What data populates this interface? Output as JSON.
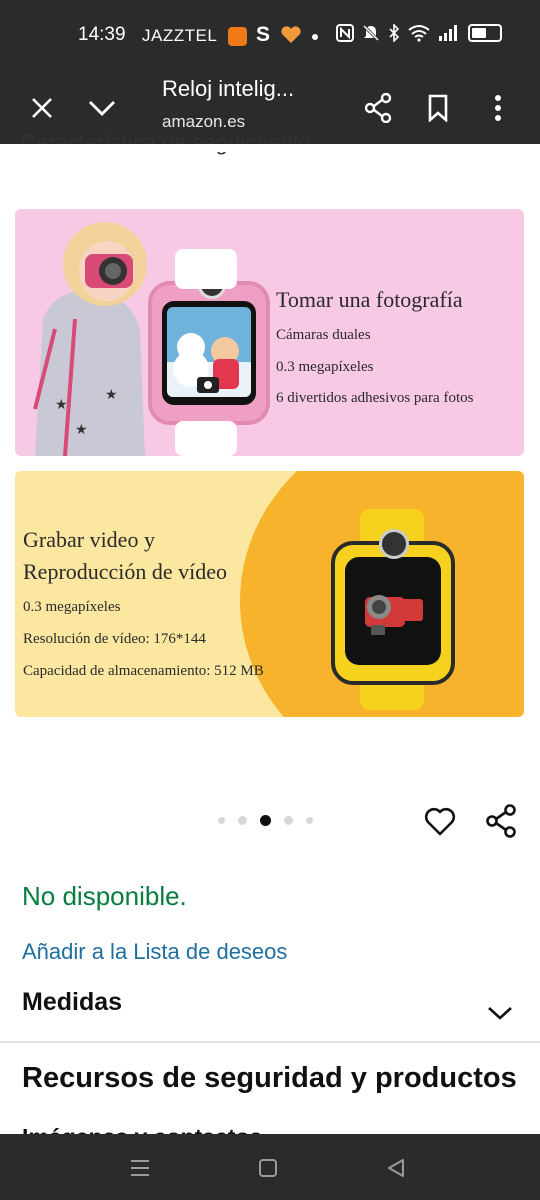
{
  "status_bar": {
    "time": "14:39",
    "carrier": "JAZZTEL",
    "s_icon": "S"
  },
  "toolbar": {
    "page_title": "Reloj intelig...",
    "domain": "amazon.es"
  },
  "clipped_text": "Característica de seguimiento",
  "banner1": {
    "title": "Tomar una fotografía",
    "lines": [
      "Cámaras duales",
      "0.3 megapíxeles",
      "6 divertidos adhesivos para fotos"
    ]
  },
  "banner2": {
    "title_line1": "Grabar video y",
    "title_line2": "Reproducción de vídeo",
    "lines": [
      "0.3 megapíxeles",
      "Resolución de vídeo: 176*144",
      "Capacidad de almacenamiento: 512 MB"
    ]
  },
  "carousel": {
    "current_index": 3,
    "total": 5
  },
  "product": {
    "availability": "No disponible.",
    "wishlist_link": "Añadir a la Lista de deseos",
    "measures_heading": "Medidas",
    "safety_heading": "Recursos de seguridad y productos",
    "images_heading": "Imágenes y contactos"
  },
  "colors": {
    "bar_bg": "#2b2b2b",
    "availability": "#067d3e",
    "link": "#1f6fa0",
    "banner_pink": "#f7c9e5",
    "banner_yellow": "#fce7a0",
    "banner_orange": "#f7b32b"
  },
  "icons": [
    "close-icon",
    "chevron-down-icon",
    "share-icon",
    "bookmark-icon",
    "more-vert-icon",
    "heart-icon",
    "share-icon",
    "nav-menu-icon",
    "nav-home-icon",
    "nav-back-icon"
  ]
}
